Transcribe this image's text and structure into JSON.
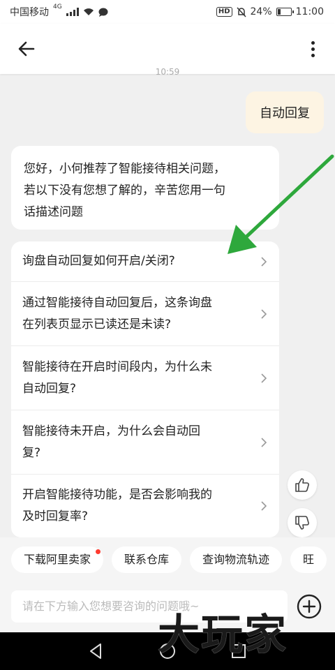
{
  "status_bar": {
    "carrier": "中国移动",
    "network": "4G",
    "battery": "24%",
    "battery_level": 0.24,
    "time": "11:00",
    "hd_label": "HD"
  },
  "header": {
    "back_icon": "back-arrow-icon",
    "more_icon": "more-vertical-icon"
  },
  "chat": {
    "timestamp": "10:59",
    "user_message": "自动回复",
    "bot_lines": [
      "您好，小何推荐了智能接待相关问题，",
      "若以下没有您想了解的，辛苦您用一句",
      "话描述问题"
    ],
    "faq": [
      {
        "line1": "询盘自动回复如何开启/关闭?",
        "line2": ""
      },
      {
        "line1": "通过智能接待自动回复后，这条询盘",
        "line2": "在列表页显示已读还是未读?"
      },
      {
        "line1": "智能接待在开启时间段内，为什么未",
        "line2": "自动回复?"
      },
      {
        "line1": "智能接待未开启，为什么会自动回",
        "line2": "复?"
      },
      {
        "line1": "开启智能接待功能，是否会影响我的",
        "line2": "及时回复率?"
      }
    ]
  },
  "quick_actions": [
    "下载阿里卖家",
    "联系仓库",
    "查询物流轨迹",
    "旺"
  ],
  "input": {
    "placeholder": "请在下方输入您想要咨询的问题哦~"
  },
  "watermark": "大玩家",
  "colors": {
    "annotation_arrow": "#2ea83c",
    "user_bubble": "#fdf4e3",
    "badge_dot": "#ff3b30"
  }
}
